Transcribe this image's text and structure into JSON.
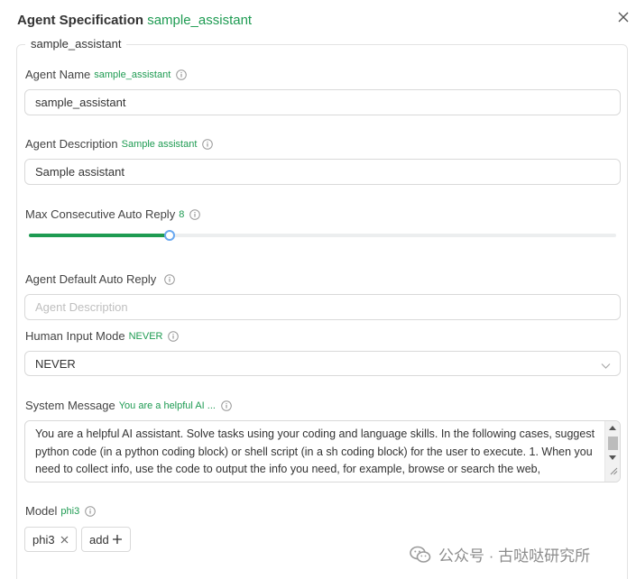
{
  "modal": {
    "title": "Agent Specification",
    "title_value": "sample_assistant",
    "close_icon": "close-icon"
  },
  "fieldset": {
    "legend": "sample_assistant"
  },
  "agent_name": {
    "label": "Agent Name",
    "tag": "sample_assistant",
    "value": "sample_assistant"
  },
  "agent_description": {
    "label": "Agent Description",
    "tag": "Sample assistant",
    "value": "Sample assistant"
  },
  "max_auto_reply": {
    "label": "Max Consecutive Auto Reply",
    "tag": "8",
    "value": 8,
    "min": 0,
    "max": 30,
    "fraction": 0.24
  },
  "default_auto_reply": {
    "label": "Agent Default Auto Reply",
    "placeholder": "Agent Description"
  },
  "human_input_mode": {
    "label": "Human Input Mode",
    "tag": "NEVER",
    "selected": "NEVER"
  },
  "system_message": {
    "label": "System Message",
    "tag": "You are a helpful AI ...",
    "value": "You are a helpful AI assistant. Solve tasks using your coding and language skills. In the following cases, suggest python code (in a python coding block) or shell script (in a sh coding block) for the user to execute. 1. When you need to collect info, use the code to output the info you need, for example, browse or search the web,"
  },
  "model": {
    "label": "Model",
    "tag": "phi3",
    "chips": [
      "phi3"
    ],
    "add_label": "add"
  },
  "watermark": {
    "text": "公众号 · 古哒哒研究所"
  },
  "colors": {
    "accent": "#1e9b52",
    "slider_handle": "#69a8f0",
    "border": "#d9d9d9"
  }
}
